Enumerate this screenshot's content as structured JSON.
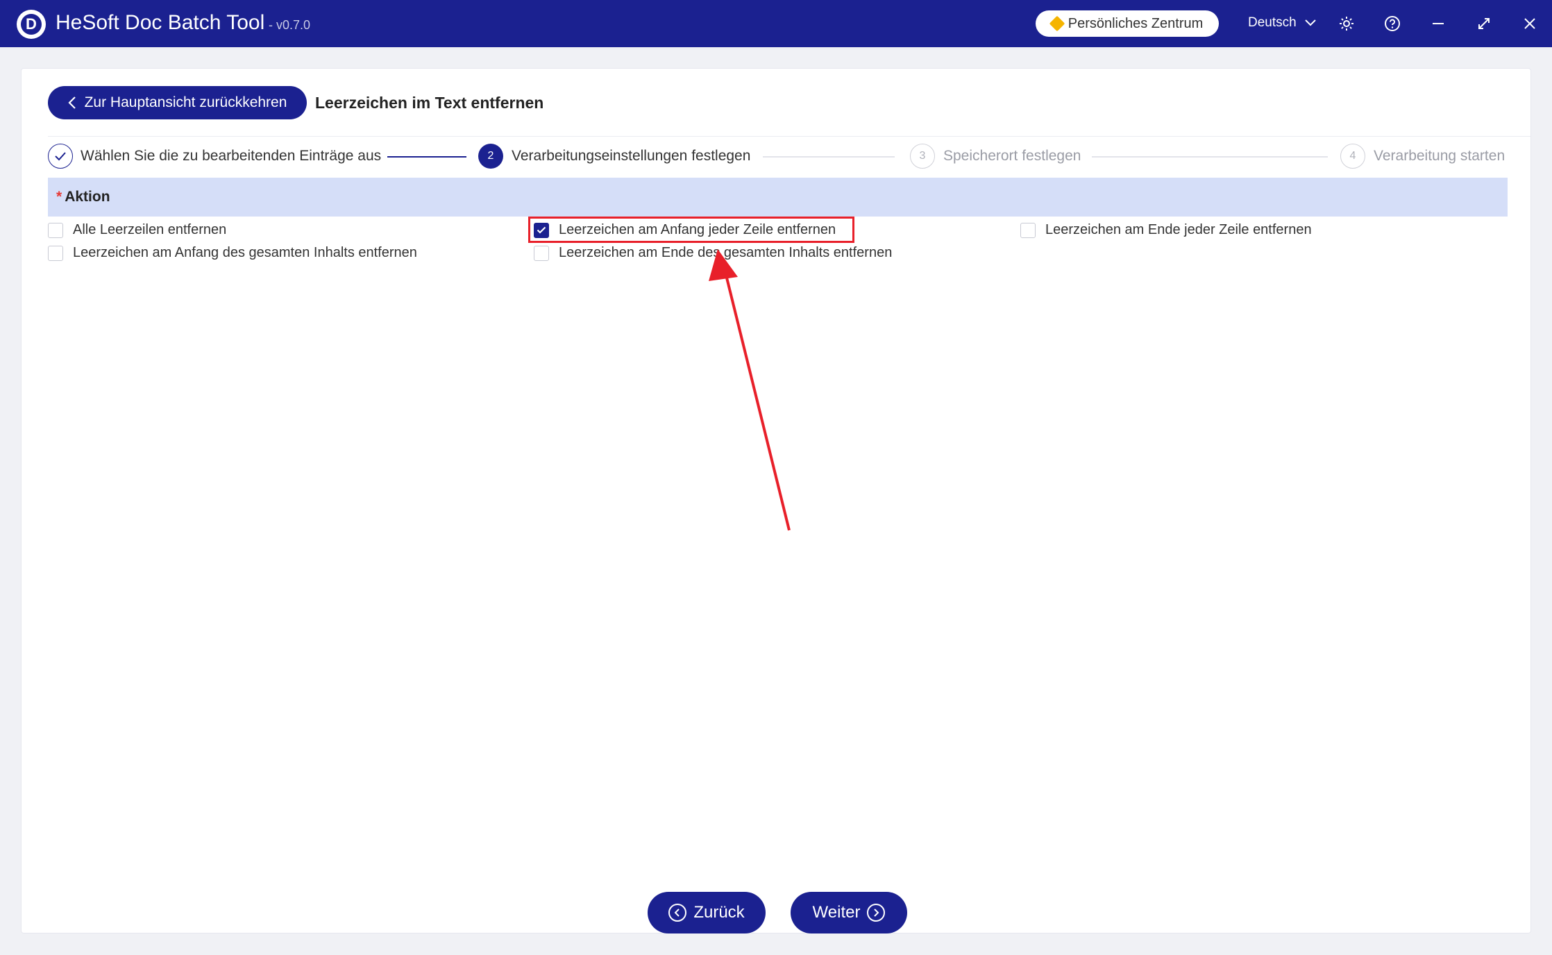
{
  "app": {
    "title": "HeSoft Doc Batch Tool",
    "version": "- v0.7.0"
  },
  "header": {
    "user_center": "Persönliches Zentrum",
    "language": "Deutsch"
  },
  "page": {
    "back_label": "Zur Hauptansicht zurückkehren",
    "title": "Leerzeichen im Text entfernen"
  },
  "steps": [
    {
      "number": "✓",
      "label": "Wählen Sie die zu bearbeitenden Einträge aus",
      "state": "done"
    },
    {
      "number": "2",
      "label": "Verarbeitungseinstellungen festlegen",
      "state": "active"
    },
    {
      "number": "3",
      "label": "Speicherort festlegen",
      "state": "pending"
    },
    {
      "number": "4",
      "label": "Verarbeitung starten",
      "state": "pending"
    }
  ],
  "section": {
    "required_mark": "*",
    "label": "Aktion"
  },
  "options": [
    {
      "label": "Alle Leerzeilen entfernen",
      "checked": false
    },
    {
      "label": "Leerzeichen am Anfang jeder Zeile entfernen",
      "checked": true
    },
    {
      "label": "Leerzeichen am Ende jeder Zeile entfernen",
      "checked": false
    },
    {
      "label": "Leerzeichen am Anfang des gesamten Inhalts entfernen",
      "checked": false
    },
    {
      "label": "Leerzeichen am Ende des gesamten Inhalts entfernen",
      "checked": false
    }
  ],
  "footer": {
    "back_label": "Zurück",
    "next_label": "Weiter"
  },
  "colors": {
    "primary": "#1b2190",
    "highlight": "#e8202a",
    "section_bg": "#d5def8"
  }
}
